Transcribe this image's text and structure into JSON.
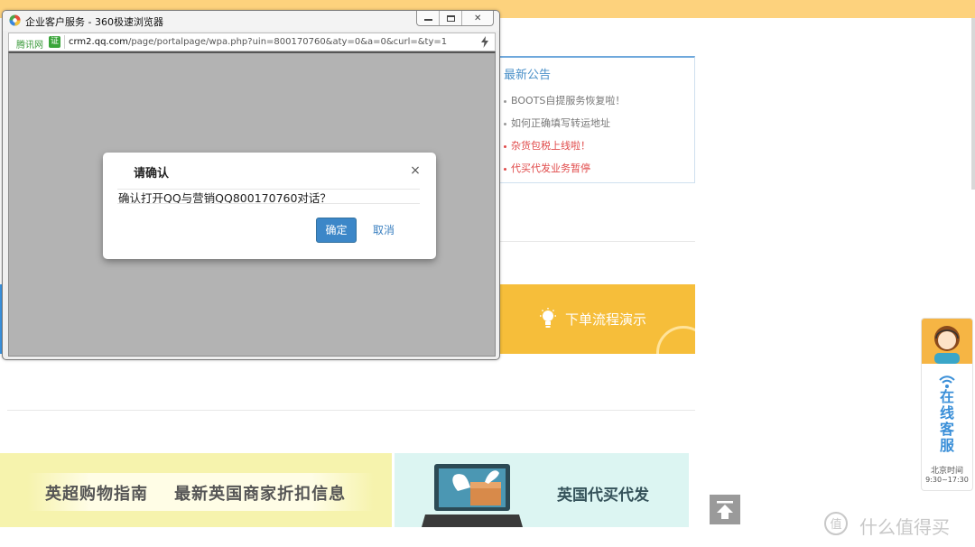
{
  "background": {
    "notice": {
      "title": "最新公告",
      "items": [
        {
          "label": "BOOTS自提服务恢复啦！",
          "highlight": false
        },
        {
          "label": "如何正确填写转运地址",
          "highlight": false
        },
        {
          "label": "杂货包税上线啦！",
          "highlight": true
        },
        {
          "label": "代买代发业务暂停",
          "highlight": true
        }
      ]
    },
    "order_banner": {
      "label": "下单流程演示",
      "icon": "lightbulb-icon"
    },
    "guide_banner": {
      "label": "英超购物指南    最新英国商家折扣信息"
    },
    "proxy_banner": {
      "label": "英国代买代发",
      "icon": "laptop-box-icon"
    },
    "scroll_top": {
      "icon": "scroll-to-top-icon"
    },
    "customer_service": {
      "icon": "agent-avatar-icon",
      "chars": [
        "在",
        "线",
        "客",
        "服"
      ],
      "hours_label": "北京时间",
      "hours": "9:30~17:30"
    },
    "watermark": {
      "text": "什么值得买",
      "icon": "zhi-logo-icon"
    },
    "colors": {
      "top_strip": "#fdd27d",
      "order_banner": "#f6be3a",
      "accent_blue": "#3a8fd8",
      "alert_red": "#e04a4a"
    }
  },
  "browser": {
    "title": "企业客户服务 - 360极速浏览器",
    "window_buttons": [
      "minimize",
      "restore",
      "close"
    ],
    "address": {
      "site_label": "腾讯网",
      "cert_badge": "证",
      "host": "crm2.qq.com",
      "path": "/page/portalpage/wpa.php?uin=800170760&aty=0&a=0&curl=&ty=1"
    },
    "dialog": {
      "title": "请确认",
      "close_label": "×",
      "message": "确认打开QQ与营销QQ800170760对话？",
      "ok_label": "确定",
      "cancel_label": "取消"
    },
    "colors": {
      "overlay": "#b3b3b3",
      "ok_button": "#3c87c8"
    }
  }
}
